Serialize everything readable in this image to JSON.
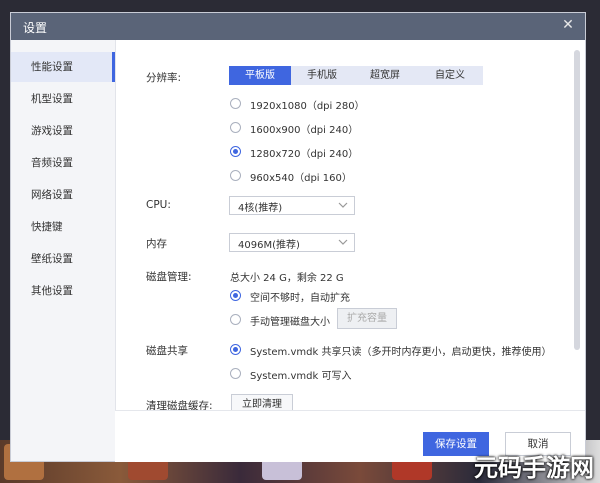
{
  "window": {
    "title": "设置"
  },
  "sidebar": {
    "items": [
      {
        "label": "性能设置",
        "active": true
      },
      {
        "label": "机型设置"
      },
      {
        "label": "游戏设置"
      },
      {
        "label": "音频设置"
      },
      {
        "label": "网络设置"
      },
      {
        "label": "快捷键"
      },
      {
        "label": "壁纸设置"
      },
      {
        "label": "其他设置"
      }
    ]
  },
  "resolution": {
    "label": "分辨率:",
    "tabs": [
      "平板版",
      "手机版",
      "超宽屏",
      "自定义"
    ],
    "selected_tab": "平板版",
    "options": [
      "1920x1080（dpi 280）",
      "1600x900（dpi 240）",
      "1280x720（dpi 240）",
      "960x540（dpi 160）"
    ],
    "selected_option": "1280x720（dpi 240）"
  },
  "cpu": {
    "label": "CPU:",
    "value": "4核(推荐)"
  },
  "memory": {
    "label": "内存",
    "value": "4096M(推荐)"
  },
  "disk": {
    "label": "磁盘管理:",
    "summary": "总大小 24 G，剩余 22 G",
    "options": [
      "空间不够时，自动扩充",
      "手动管理磁盘大小"
    ],
    "selected_option": "空间不够时，自动扩充",
    "expand_button": "扩充容量"
  },
  "share": {
    "label": "磁盘共享",
    "options": [
      "System.vmdk 共享只读（多开时内存更小，启动更快，推荐使用）",
      "System.vmdk 可写入"
    ],
    "selected_option": "System.vmdk 共享只读（多开时内存更小，启动更快，推荐使用）"
  },
  "cache": {
    "label": "清理磁盘缓存:",
    "button": "立即清理"
  },
  "footer": {
    "save": "保存设置",
    "cancel": "取消"
  },
  "watermark": "元码手游网",
  "icons": {
    "close": "close-icon",
    "chevron": "chevron-down-icon"
  },
  "colors": {
    "accent": "#3f66e0",
    "titlebar": "#5a6478"
  }
}
